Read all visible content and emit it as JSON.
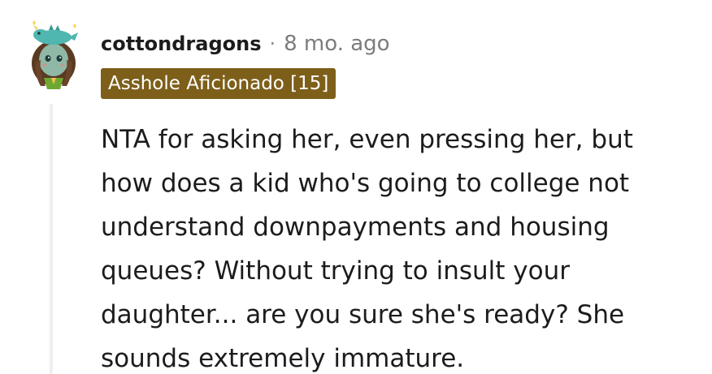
{
  "comment": {
    "username": "cottondragons",
    "separator": "·",
    "timestamp": "8 mo. ago",
    "flair": "Asshole Aficionado [15]",
    "body_lines": [
      "NTA for asking her, even pressing her, but",
      "how does a kid who's going to college not",
      "understand downpayments and housing",
      "queues? Without trying to insult your",
      "daughter... are you sure she's ready? She",
      "sounds extremely immature."
    ]
  },
  "colors": {
    "flair_bg": "#7d5f1a",
    "thread_line": "#edeff1",
    "text": "#1c1c1c",
    "meta": "#7c7c7c"
  }
}
